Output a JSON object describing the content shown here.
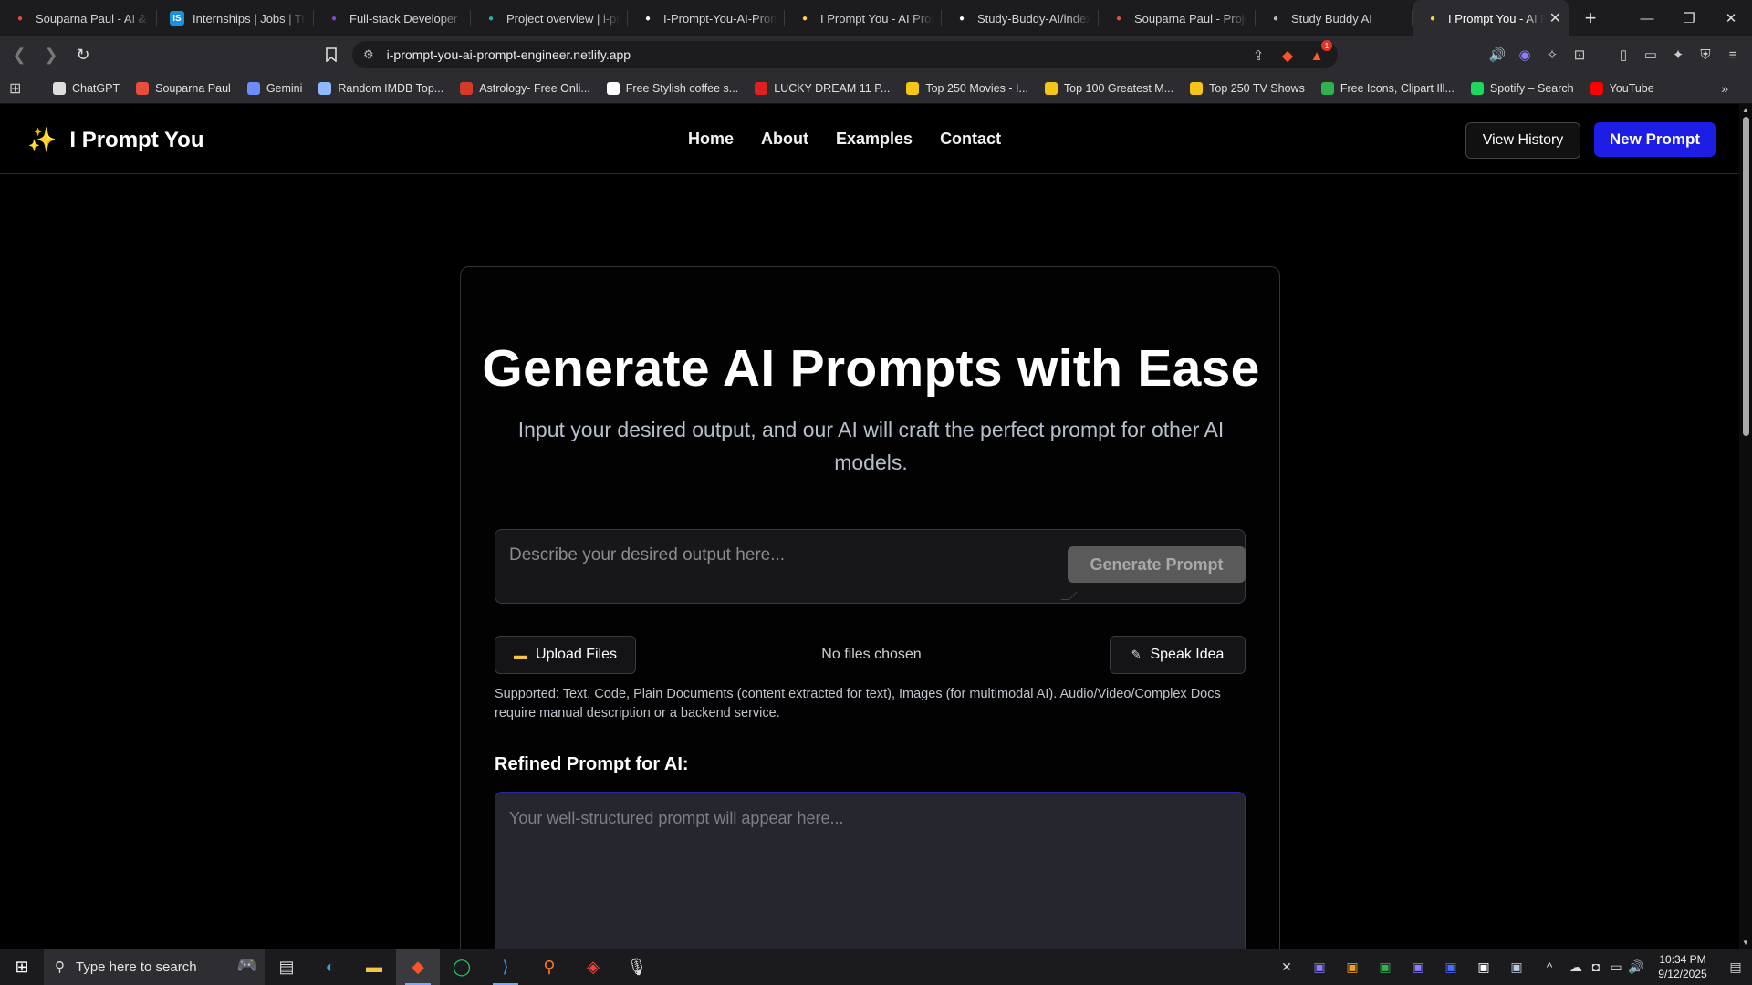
{
  "browser": {
    "tabs": [
      {
        "title": "Souparna Paul - AI & F",
        "icon_color": "#e94e3c",
        "icon_text": ""
      },
      {
        "title": "Internships | Jobs | Trai",
        "icon_color": "#1b8fe0",
        "icon_text": "IS"
      },
      {
        "title": "Full-stack Developer In",
        "icon_color": "#7d4bd6",
        "icon_text": ""
      },
      {
        "title": "Project overview | i-pro",
        "icon_color": "#1fb6a6",
        "icon_text": ""
      },
      {
        "title": "I-Prompt-You-AI-Prom",
        "icon_color": "#ffffff",
        "icon_text": ""
      },
      {
        "title": "I Prompt You - AI Prom",
        "icon_color": "#ffd43b",
        "icon_text": ""
      },
      {
        "title": "Study-Buddy-AI/index.",
        "icon_color": "#ffffff",
        "icon_text": ""
      },
      {
        "title": "Souparna Paul - Projec",
        "icon_color": "#e94e3c",
        "icon_text": ""
      },
      {
        "title": "Study Buddy AI",
        "icon_color": "#bbbbbb",
        "icon_text": ""
      },
      {
        "title": "I Prompt You - AI P",
        "icon_color": "#ffd43b",
        "icon_text": "",
        "active": true
      }
    ],
    "url": "i-prompt-you-ai-prompt-engineer.netlify.app",
    "shield_badge": "1",
    "bookmarks": [
      {
        "label": "ChatGPT",
        "color": "#dddddd"
      },
      {
        "label": "Souparna Paul",
        "color": "#e94e3c"
      },
      {
        "label": "Gemini",
        "color": "#6c8cff"
      },
      {
        "label": "Random IMDB Top...",
        "color": "#8fb8ff"
      },
      {
        "label": "Astrology- Free Onli...",
        "color": "#d33a2c"
      },
      {
        "label": "Free Stylish coffee s...",
        "color": "#ffffff"
      },
      {
        "label": "LUCKY DREAM 11 P...",
        "color": "#e02020"
      },
      {
        "label": "Top 250 Movies - I...",
        "color": "#f5c518"
      },
      {
        "label": "Top 100 Greatest M...",
        "color": "#f5c518"
      },
      {
        "label": "Top 250 TV Shows",
        "color": "#f5c518"
      },
      {
        "label": "Free Icons, Clipart Ill...",
        "color": "#2fb24c"
      },
      {
        "label": "Spotify – Search",
        "color": "#1ed760"
      },
      {
        "label": "YouTube",
        "color": "#ff0000"
      }
    ]
  },
  "site": {
    "logo_text": "I Prompt You",
    "logo_icon": "✨",
    "nav": [
      "Home",
      "About",
      "Examples",
      "Contact"
    ],
    "view_history": "View History",
    "new_prompt": "New Prompt",
    "accent_color": "#1d1de6"
  },
  "main": {
    "title": "Generate AI Prompts with Ease",
    "subtitle": "Input your desired output, and our AI will craft the perfect prompt for other AI models.",
    "input_placeholder": "Describe your desired output here...",
    "generate_button": "Generate Prompt",
    "upload_button": "Upload Files",
    "no_files": "No files chosen",
    "speak_button": "Speak Idea",
    "supported_text": "Supported: Text, Code, Plain Documents (content extracted for text), Images (for multimodal AI). Audio/Video/Complex Docs require manual description or a backend service.",
    "refined_label": "Refined Prompt for AI:",
    "output_placeholder": "Your well-structured prompt will appear here..."
  },
  "taskbar": {
    "search_placeholder": "Type here to search",
    "time": "10:34 PM",
    "date": "9/12/2025"
  }
}
